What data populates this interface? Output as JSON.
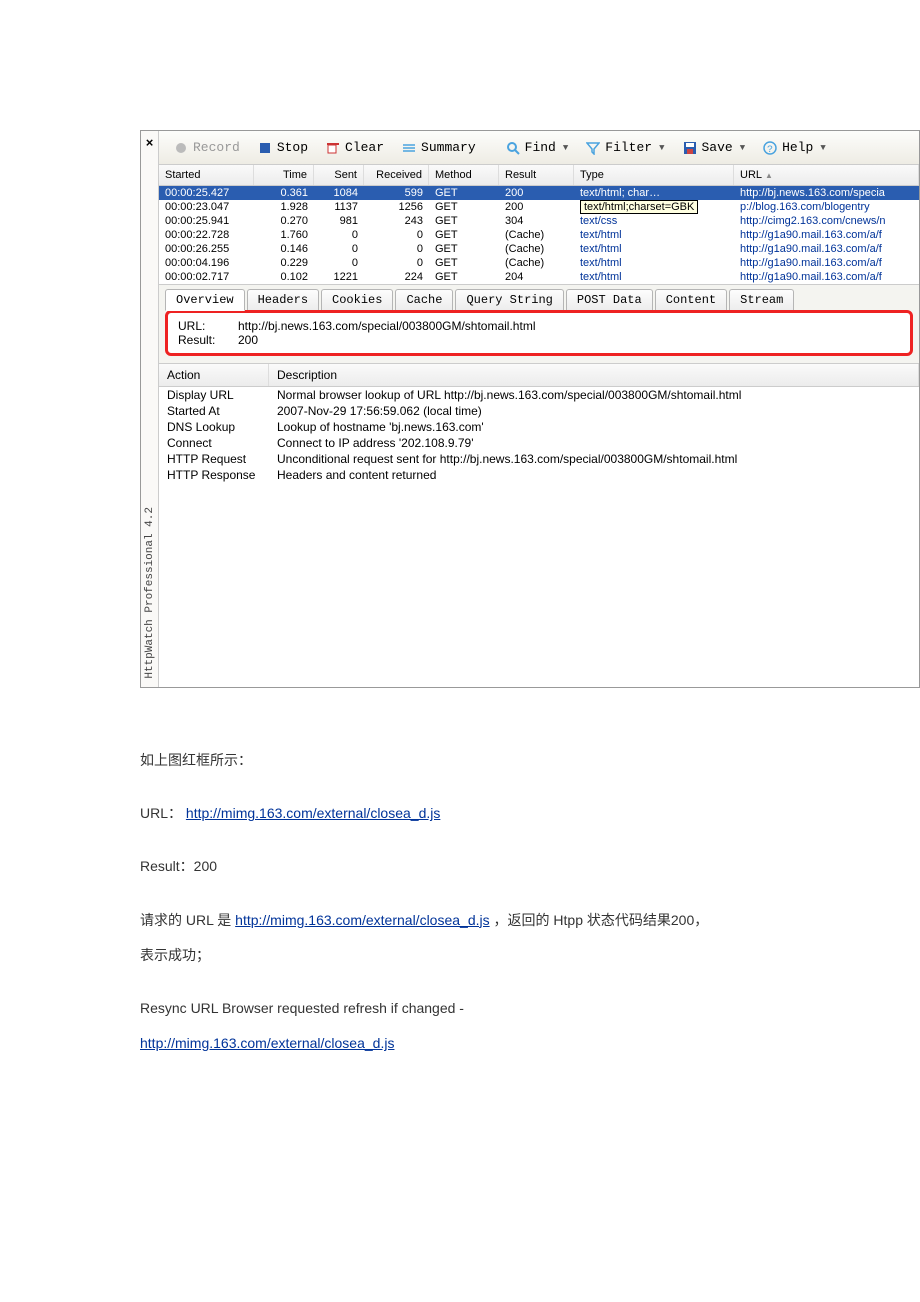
{
  "app": {
    "product_label": "HttpWatch Professional 4.2",
    "close_x": "×"
  },
  "toolbar": {
    "record": "Record",
    "stop": "Stop",
    "clear": "Clear",
    "summary": "Summary",
    "find": "Find",
    "filter": "Filter",
    "save": "Save",
    "help": "Help"
  },
  "grid": {
    "columns": {
      "started": "Started",
      "time": "Time",
      "sent": "Sent",
      "received": "Received",
      "method": "Method",
      "result": "Result",
      "type": "Type",
      "url": "URL"
    },
    "rows": [
      {
        "started": "00:00:25.427",
        "time": "0.361",
        "sent": "1084",
        "received": "599",
        "method": "GET",
        "result": "200",
        "type": "text/html; char…",
        "url": "http://bj.news.163.com/specia",
        "sel": true
      },
      {
        "started": "00:00:23.047",
        "time": "1.928",
        "sent": "1137",
        "received": "1256",
        "method": "GET",
        "result": "200",
        "type_tooltip": "text/html;charset=GBK",
        "url": "p://blog.163.com/blogentry"
      },
      {
        "started": "00:00:25.941",
        "time": "0.270",
        "sent": "981",
        "received": "243",
        "method": "GET",
        "result": "304",
        "type": "text/css",
        "url": "http://cimg2.163.com/cnews/n"
      },
      {
        "started": "00:00:22.728",
        "time": "1.760",
        "sent": "0",
        "received": "0",
        "method": "GET",
        "result": "(Cache)",
        "type": "text/html",
        "url": "http://g1a90.mail.163.com/a/f"
      },
      {
        "started": "00:00:26.255",
        "time": "0.146",
        "sent": "0",
        "received": "0",
        "method": "GET",
        "result": "(Cache)",
        "type": "text/html",
        "url": "http://g1a90.mail.163.com/a/f"
      },
      {
        "started": "00:00:04.196",
        "time": "0.229",
        "sent": "0",
        "received": "0",
        "method": "GET",
        "result": "(Cache)",
        "type": "text/html",
        "url": "http://g1a90.mail.163.com/a/f"
      },
      {
        "started": "00:00:02.717",
        "time": "0.102",
        "sent": "1221",
        "received": "224",
        "method": "GET",
        "result": "204",
        "type": "text/html",
        "url": "http://g1a90.mail.163.com/a/f"
      }
    ]
  },
  "tabs": {
    "overview": "Overview",
    "headers": "Headers",
    "cookies": "Cookies",
    "cache": "Cache",
    "query": "Query String",
    "post": "POST Data",
    "content": "Content",
    "stream": "Stream"
  },
  "summary_box": {
    "url_label": "URL:",
    "url_value": "http://bj.news.163.com/special/003800GM/shtomail.html",
    "result_label": "Result:",
    "result_value": "200"
  },
  "details": {
    "action_h": "Action",
    "desc_h": "Description",
    "rows": [
      {
        "a": "Display URL",
        "d": "Normal browser lookup of URL http://bj.news.163.com/special/003800GM/shtomail.html"
      },
      {
        "a": "Started At",
        "d": "2007-Nov-29 17:56:59.062 (local time)"
      },
      {
        "a": "DNS Lookup",
        "d": "Lookup of hostname 'bj.news.163.com'"
      },
      {
        "a": "Connect",
        "d": "Connect to IP address '202.108.9.79'"
      },
      {
        "a": "HTTP Request",
        "d": "Unconditional request sent for http://bj.news.163.com/special/003800GM/shtomail.html"
      },
      {
        "a": "HTTP Response",
        "d": "Headers and content returned"
      }
    ]
  },
  "doc": {
    "p1": "如上图红框所示：",
    "p2a": "URL：  ",
    "p2_link": "http://mimg.163.com/external/closea_d.js",
    "p3": "Result：200",
    "p4a": "请求的 URL 是 ",
    "p4_link": "http://mimg.163.com/external/closea_d.js",
    "p4b": " ，返回的 Htpp 状态代码结果200，",
    "p5": "表示成功；",
    "p6": "Resync URL    Browser requested refresh if changed -",
    "p7_link": "http://mimg.163.com/external/closea_d.js"
  }
}
